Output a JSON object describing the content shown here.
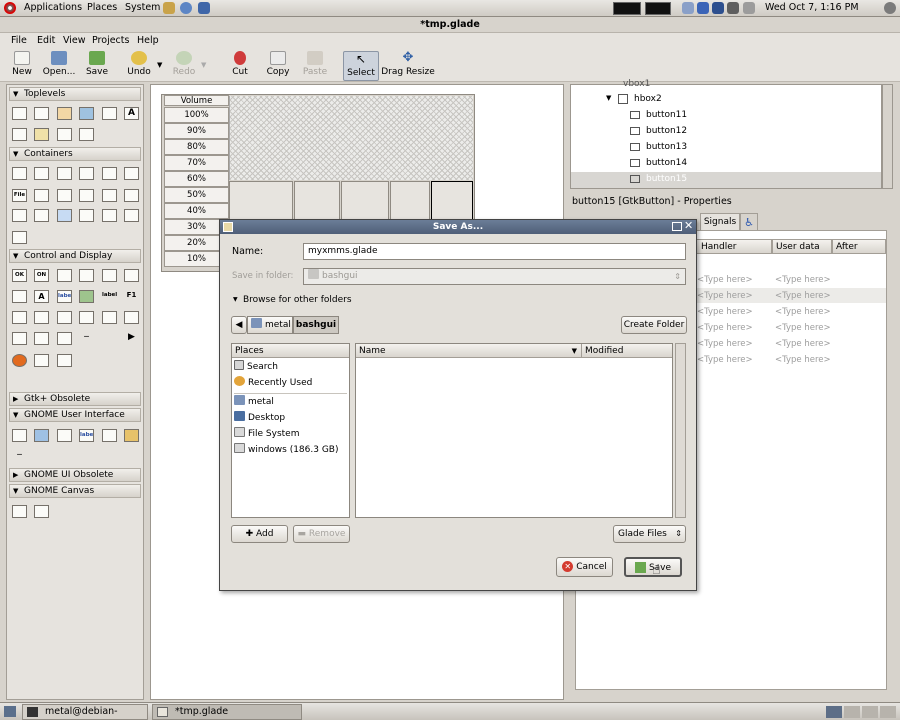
{
  "top_panel": {
    "applications": "Applications",
    "places": "Places",
    "system": "System",
    "clock": "Wed Oct  7,  1:16 PM"
  },
  "window": {
    "title": "*tmp.glade"
  },
  "menu": [
    "File",
    "Edit",
    "View",
    "Projects",
    "Help"
  ],
  "toolbar": {
    "new": "New",
    "open": "Open...",
    "save": "Save",
    "undo": "Undo",
    "redo": "Redo",
    "cut": "Cut",
    "copy": "Copy",
    "paste": "Paste",
    "select": "Select",
    "drag_resize": "Drag Resize"
  },
  "palette": {
    "toplevels": "Toplevels",
    "containers": "Containers",
    "control_display": "Control and Display",
    "gtk_obsolete": "Gtk+ Obsolete",
    "gnome_ui": "GNOME User Interface",
    "gnome_ui_obsolete": "GNOME UI Obsolete",
    "gnome_canvas": "GNOME Canvas",
    "w_ok": "OK",
    "w_on": "ON",
    "w_file": "File",
    "w_a": "A",
    "w_label": "label",
    "w_label2": "label",
    "w_f1": "F1"
  },
  "volume": {
    "header": "Volume",
    "levels": [
      "100%",
      "90%",
      "80%",
      "70%",
      "60%",
      "50%",
      "40%",
      "30%",
      "20%",
      "10%"
    ]
  },
  "tree": {
    "top_partial": "vbox1",
    "hbox": "hbox2",
    "items": [
      "button11",
      "button12",
      "button13",
      "button14",
      "button15"
    ]
  },
  "properties": {
    "title": "button15 [GtkButton] - Properties",
    "tab_signals": "Signals",
    "col_handler": "Handler",
    "col_user_data": "User data",
    "col_after": "After",
    "type_here": "<Type here>"
  },
  "taskbar": {
    "terminal": "metal@debian-gatew...",
    "glade": "*tmp.glade"
  },
  "dialog": {
    "title": "Save As...",
    "name_label": "Name:",
    "name_value": "myxmms.glade",
    "save_in_label": "Save in folder:",
    "save_in_value": "bashgui",
    "browse": "Browse for other folders",
    "crumbs": [
      "metal",
      "bashgui"
    ],
    "create_folder": "Create Folder",
    "places_header": "Places",
    "places": [
      "Search",
      "Recently Used",
      "metal",
      "Desktop",
      "File System",
      "windows (186.3 GB)"
    ],
    "col_name": "Name",
    "col_modified": "Modified",
    "add": "Add",
    "remove": "Remove",
    "filter": "Glade Files",
    "cancel": "Cancel",
    "save": "Save"
  },
  "colors": {
    "dialog_title": "#4f5f78",
    "selection": "#d8d6d2",
    "desktop": "#4a6ea0"
  }
}
